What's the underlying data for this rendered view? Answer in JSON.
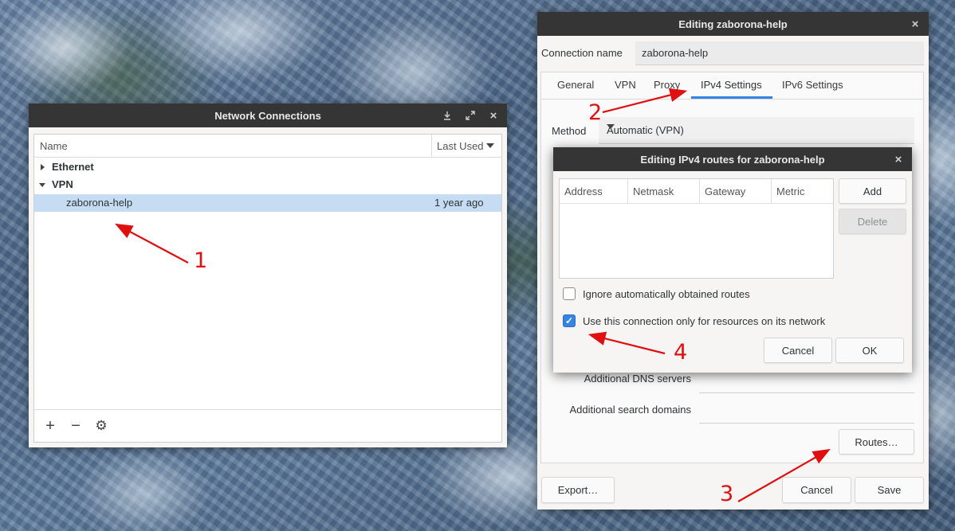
{
  "network_connections": {
    "title": "Network Connections",
    "columns": {
      "name": "Name",
      "last_used": "Last Used"
    },
    "groups": [
      {
        "label": "Ethernet",
        "expanded": false
      },
      {
        "label": "VPN",
        "expanded": true
      }
    ],
    "connections": [
      {
        "name": "zaborona-help",
        "last_used": "1 year ago",
        "selected": true
      }
    ],
    "toolbar": {
      "add_icon": "+",
      "remove_icon": "−",
      "settings_icon": "⚙"
    }
  },
  "editor": {
    "title": "Editing zaborona-help",
    "connection_name_label": "Connection name",
    "connection_name_value": "zaborona-help",
    "tabs": [
      "General",
      "VPN",
      "Proxy",
      "IPv4 Settings",
      "IPv6 Settings"
    ],
    "active_tab": "IPv4 Settings",
    "method_label": "Method",
    "method_value": "Automatic (VPN)",
    "additional_dns_label": "Additional DNS servers",
    "additional_search_label": "Additional search domains",
    "routes_button": "Routes…",
    "export_button": "Export…",
    "cancel_button": "Cancel",
    "save_button": "Save"
  },
  "routes_dialog": {
    "title": "Editing IPv4 routes for zaborona-help",
    "columns": [
      "Address",
      "Netmask",
      "Gateway",
      "Metric"
    ],
    "add_button": "Add",
    "delete_button": "Delete",
    "ignore_routes_label": "Ignore automatically obtained routes",
    "ignore_routes_checked": false,
    "only_resources_label": "Use this connection only for resources on its network",
    "only_resources_checked": true,
    "cancel_button": "Cancel",
    "ok_button": "OK"
  },
  "annotations": {
    "n1": "1",
    "n2": "2",
    "n3": "3",
    "n4": "4",
    "color": "#e01010"
  },
  "colors": {
    "titlebar": "#353535",
    "accent": "#3584e4",
    "selection": "#c5dcf3"
  }
}
